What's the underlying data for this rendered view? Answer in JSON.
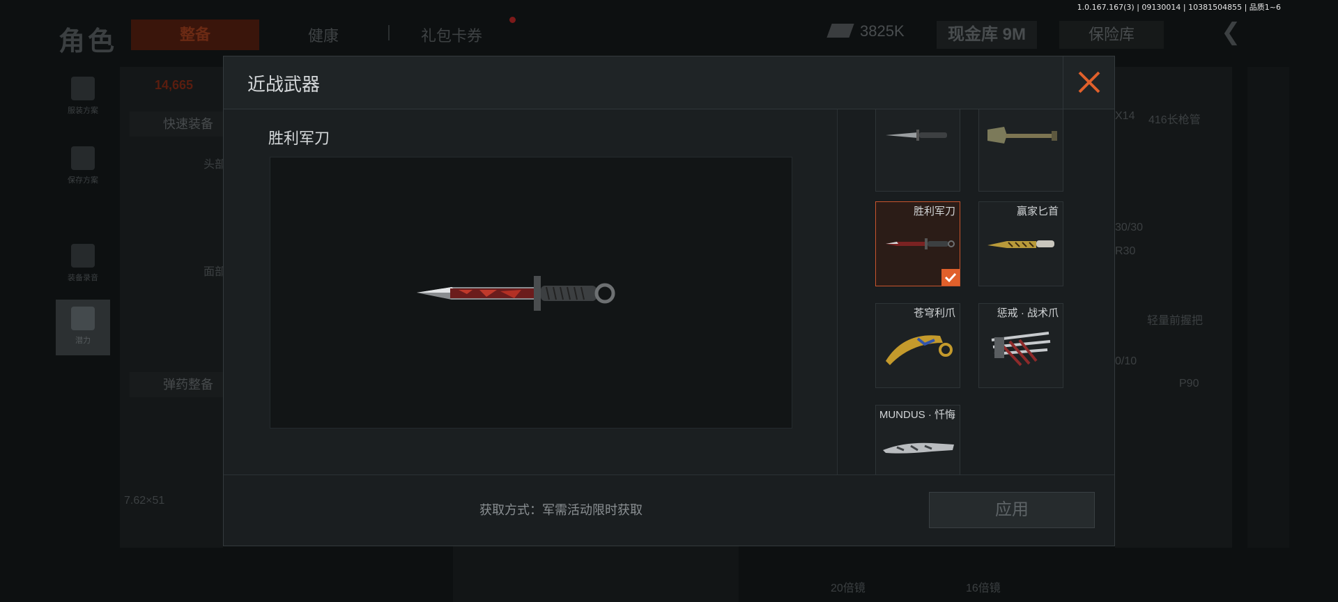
{
  "version": "1.0.167.167(3) | 09130014 | 10381504855 | 品质1~6",
  "background": {
    "title": "角色",
    "tabs": [
      "整备",
      "健康",
      "礼包卡券"
    ],
    "currency": "3825K",
    "vault": "现金库 9M",
    "safe": "保险库",
    "sidebar": [
      "服装方案",
      "保存方案",
      "装备录音",
      "潜力"
    ],
    "quick_equip": "快速装备",
    "ammo_equip": "弹药整备",
    "ammo_caliber": "7.62×51",
    "right_labels": [
      "X14",
      "416长枪管",
      "30/30",
      "R30",
      "轻量前握把",
      "0/10",
      "P90",
      "20倍镜",
      "16倍镜"
    ],
    "left_labels": [
      "头部",
      "面部"
    ],
    "red_number": "14,665"
  },
  "modal": {
    "title": "近战武器",
    "selected_name": "胜利军刀",
    "items": [
      {
        "name": "",
        "icon": "bayonet-icon",
        "selected": false
      },
      {
        "name": "",
        "icon": "shovel-icon",
        "selected": false
      },
      {
        "name": "胜利军刀",
        "icon": "victory-knife-icon",
        "selected": true
      },
      {
        "name": "赢家匕首",
        "icon": "winner-dagger-icon",
        "selected": false
      },
      {
        "name": "苍穹利爪",
        "icon": "karambit-icon",
        "selected": false
      },
      {
        "name": "惩戒 · 战术爪",
        "icon": "tactical-claw-icon",
        "selected": false
      },
      {
        "name": "MUNDUS · 忏悔",
        "icon": "mundus-knife-icon",
        "selected": false
      }
    ],
    "acquire_text": "获取方式：军需活动限时获取",
    "apply_label": "应用"
  },
  "colors": {
    "accent": "#e0602b",
    "selected_border": "#c9552d"
  }
}
